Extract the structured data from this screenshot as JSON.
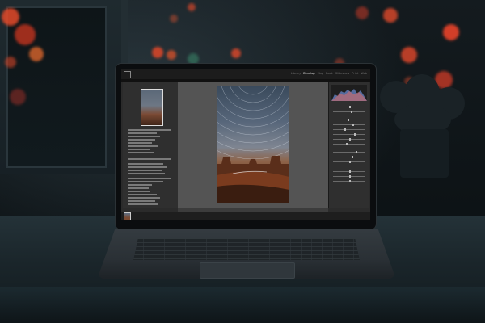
{
  "scene": {
    "description_tags": [
      "laptop-photo",
      "photo-editor-on-screen"
    ],
    "accent_bokeh_color": "#e0402a"
  },
  "app": {
    "modules": [
      "Library",
      "Develop",
      "Map",
      "Book",
      "Slideshow",
      "Print",
      "Web"
    ],
    "active_module": "Develop"
  },
  "photo": {
    "subject": "star-trails-over-desert-buttes"
  },
  "icons": {
    "app_logo": "lr-logo-icon"
  }
}
